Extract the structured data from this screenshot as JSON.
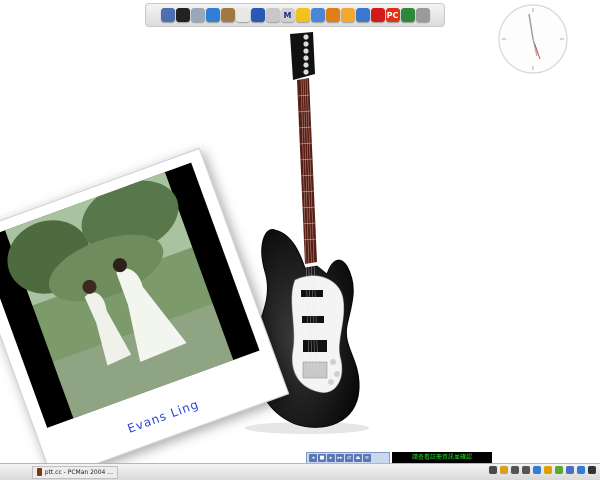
{
  "dock": {
    "items": [
      {
        "name": "finder",
        "color": "#4b6fb0",
        "glyph": ""
      },
      {
        "name": "dashboard",
        "color": "#222222",
        "glyph": ""
      },
      {
        "name": "mail",
        "color": "#9aa7b8",
        "glyph": ""
      },
      {
        "name": "safari",
        "color": "#2f7fd6",
        "glyph": ""
      },
      {
        "name": "address-book",
        "color": "#a07a42",
        "glyph": ""
      },
      {
        "name": "ical",
        "color": "#e8e8e8",
        "glyph": ""
      },
      {
        "name": "system-preferences",
        "color": "#2b57b5",
        "glyph": ""
      },
      {
        "name": "preview",
        "color": "#c8c8c8",
        "glyph": ""
      },
      {
        "name": "mail-m",
        "color": "#d0d0d0",
        "glyph": "M"
      },
      {
        "name": "messenger",
        "color": "#f2c21a",
        "glyph": ""
      },
      {
        "name": "itunes",
        "color": "#4a86d6",
        "glyph": ""
      },
      {
        "name": "emoticon",
        "color": "#e07f18",
        "glyph": ""
      },
      {
        "name": "adium",
        "color": "#f0a830",
        "glyph": ""
      },
      {
        "name": "pictures",
        "color": "#3a78d0",
        "glyph": ""
      },
      {
        "name": "record",
        "color": "#d21a1a",
        "glyph": ""
      },
      {
        "name": "pc-game",
        "color": "#e03018",
        "glyph": "PC"
      },
      {
        "name": "network",
        "color": "#2e8a3a",
        "glyph": ""
      },
      {
        "name": "trash",
        "color": "#9a9a9a",
        "glyph": ""
      }
    ]
  },
  "polaroid": {
    "caption": "Evans Ling"
  },
  "taskbar": {
    "start_icon": "",
    "task_label": "ptt.cc - PCMan 2004 ...",
    "tray": [
      {
        "name": "chat-icon",
        "color": "#4a4a4a"
      },
      {
        "name": "shield-icon",
        "color": "#d8a020"
      },
      {
        "name": "plus-icon",
        "color": "#555555"
      },
      {
        "name": "speaker-icon",
        "color": "#555555"
      },
      {
        "name": "network-icon",
        "color": "#2f7fd6"
      },
      {
        "name": "warning-icon",
        "color": "#e0a000"
      },
      {
        "name": "color-icon",
        "color": "#5aa832"
      },
      {
        "name": "display-icon",
        "color": "#4a70c0"
      },
      {
        "name": "ie-icon",
        "color": "#2f7fd6"
      },
      {
        "name": "search-icon",
        "color": "#333333"
      }
    ]
  },
  "media_player": {
    "buttons": [
      "prev-icon",
      "stop-icon",
      "play-icon",
      "next-icon",
      "shuffle-icon",
      "eject-icon",
      "menu-icon"
    ]
  },
  "ticker": {
    "text": "請查看註冊資訊並確認"
  }
}
